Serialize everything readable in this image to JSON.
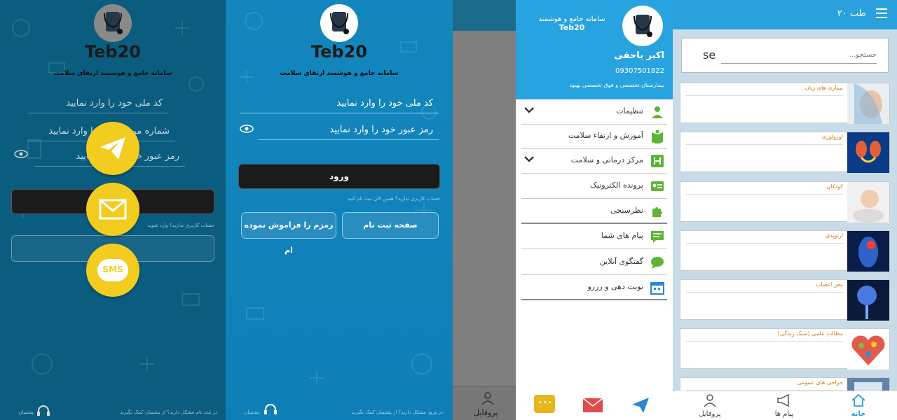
{
  "brand": {
    "name": "Teb20",
    "tagline": "سامانه جامع و هوشمند ارتقای سلامت"
  },
  "login_overlay": {
    "national_code_placeholder": "کد ملی خود را وارد نمایید",
    "mobile_placeholder": "شماره موبایل خود را وارد نمایید",
    "password_placeholder": "رمز عبور خود را وارد نمایید",
    "no_account_note": "حساب کاربری ندارید؟ وارد شوید",
    "footer_note": "در ثبت نام مشکل دارید؟ از پشتیبان کمک بگیرید",
    "support_label": "پشتیبان",
    "fab_sms_label": "SMS"
  },
  "login": {
    "national_code_placeholder": "کد ملی خود را وارد نمایید",
    "password_placeholder": "رمز عبور خود را وارد نمایید",
    "login_button": "ورود",
    "no_account_note": "حساب کاربری ندارید؟ همین الان ثبت نام کنید",
    "register_button": "صفحه ثبت نام",
    "forgot_button": "رمزم را فراموش نموده ام",
    "footer_note": "در ورود مشکل دارید؟ از پشتیبان کمک بگیرید",
    "support_label": "پشتیبان"
  },
  "dimmed": {
    "tab_profile_label": "پروفایل"
  },
  "drawer": {
    "app_title_line1": "سامانه جامع و هوشمند",
    "app_title_line2": "Teb20",
    "user_name": "اکبر یاحقی",
    "user_phone": "09307501822",
    "user_hospital": "بیمارستان تخصصی و فوق تخصصی بهبود",
    "items": [
      {
        "label": "تنظیمات",
        "icon": "user-icon",
        "has_chevron": true
      },
      {
        "label": "آموزش و ارتقاء سلامت",
        "icon": "book-icon",
        "has_chevron": false
      },
      {
        "label": "مرکز درمانی و سلامت",
        "icon": "hospital-icon",
        "has_chevron": true
      },
      {
        "label": "پرونده الکترونیک",
        "icon": "id-card-icon",
        "has_chevron": false
      },
      {
        "label": "نظرسنجی",
        "icon": "puzzle-icon",
        "has_chevron": false
      },
      {
        "label": "پیام های شما",
        "icon": "message-icon",
        "has_chevron": false
      },
      {
        "label": "گفتگوی آنلاین",
        "icon": "chat-icon",
        "has_chevron": false
      },
      {
        "label": "نوبت دهی و رزرو",
        "icon": "calendar-icon",
        "has_chevron": false
      }
    ]
  },
  "home": {
    "app_title": "طب ۲۰",
    "search_placeholder": "جستجو...",
    "search_prefix": "se",
    "cards": [
      {
        "title": "بیماری های زنان",
        "thumb": "face-thumb"
      },
      {
        "title": "اورولوژی",
        "thumb": "kidney-thumb"
      },
      {
        "title": "کودکان",
        "thumb": "baby-thumb"
      },
      {
        "title": "ارتوپدی",
        "thumb": "bone-thumb"
      },
      {
        "title": "مغز اعصاب",
        "thumb": "brain-thumb"
      },
      {
        "title": "مطالب علمی (سبک زندگی)",
        "thumb": "lifestyle-thumb"
      },
      {
        "title": "جراحی های عمومی",
        "thumb": "surgery-thumb"
      }
    ],
    "tabs": [
      {
        "label": "خانه",
        "icon": "home-icon",
        "active": true
      },
      {
        "label": "پیام ها",
        "icon": "megaphone-icon",
        "active": false
      },
      {
        "label": "پروفایل",
        "icon": "person-icon",
        "active": false
      }
    ]
  },
  "colors": {
    "accent_blue": "#27a3e0",
    "fab_yellow": "#f2cc1f",
    "card_title_orange": "#d07a1a",
    "icon_green": "#5fb336"
  }
}
